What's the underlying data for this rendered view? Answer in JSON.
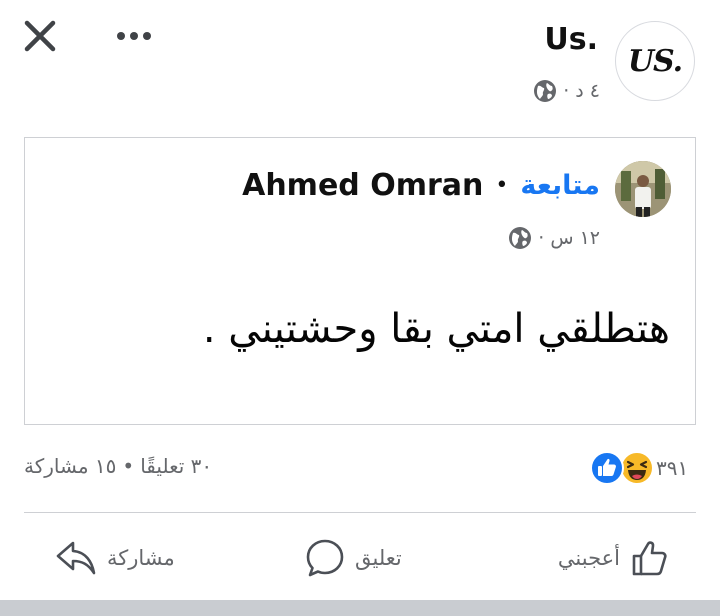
{
  "header": {
    "close_icon": "close-icon",
    "more_icon": "more-horizontal-icon"
  },
  "page": {
    "name": "Us.",
    "logo_text": "US.",
    "time": "٤ د ·",
    "privacy_icon": "globe-icon"
  },
  "shared_post": {
    "author_name": "Ahmed Omran",
    "separator": "•",
    "follow_label": "متابعة",
    "time": "١٢ س ·",
    "privacy_icon": "globe-icon",
    "text": "هتطلقي امتي بقا وحشتيني ."
  },
  "stats": {
    "reaction_count": "٣٩١",
    "reactions": [
      "haha",
      "like"
    ],
    "comments": "٣٠ تعليقًا",
    "dot": "•",
    "shares": "١٥ مشاركة"
  },
  "actions": {
    "like_label": "أعجبني",
    "comment_label": "تعليق",
    "share_label": "مشاركة"
  },
  "colors": {
    "accent": "#1877f2",
    "secondary_text": "#65676b",
    "haha": "#f7b928",
    "divider": "#ced0d4"
  }
}
